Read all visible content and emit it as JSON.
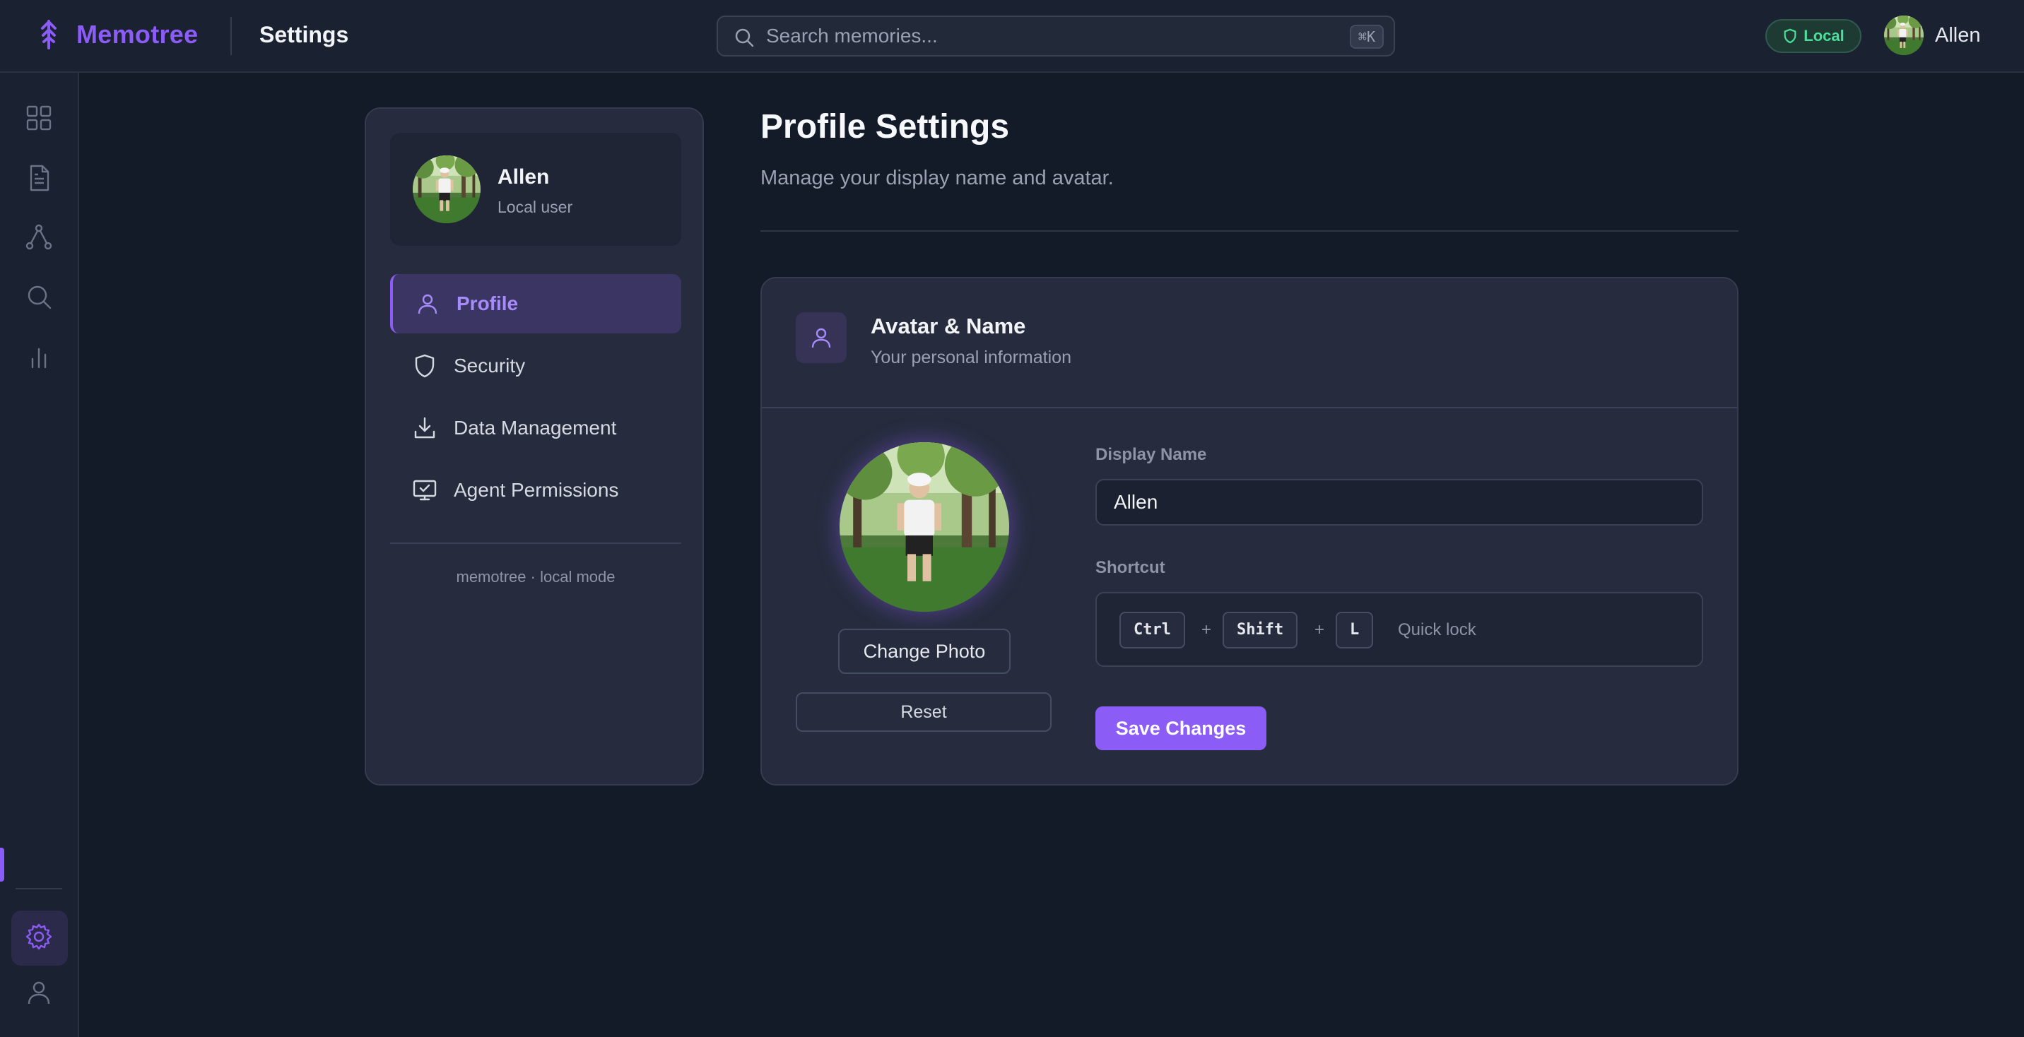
{
  "topbar": {
    "brand": "Memotree",
    "title": "Settings",
    "search_placeholder": "Search memories...",
    "search_shortcut": "⌘K",
    "mode_badge": "Local",
    "username": "Allen"
  },
  "sidebar": {
    "user_name": "Allen",
    "user_role": "Local user",
    "items": [
      {
        "label": "Profile",
        "icon": "user-icon",
        "active": true
      },
      {
        "label": "Security",
        "icon": "shield-icon",
        "active": false
      },
      {
        "label": "Data Management",
        "icon": "download-icon",
        "active": false
      },
      {
        "label": "Agent Permissions",
        "icon": "monitor-check-icon",
        "active": false
      }
    ],
    "footer": "memotree · local mode"
  },
  "rail": {
    "icons": [
      "grid-icon",
      "document-icon",
      "graph-icon",
      "search-icon",
      "chart-icon",
      "settings-icon",
      "user-icon"
    ],
    "active": "settings-icon"
  },
  "main": {
    "title": "Profile Settings",
    "subtitle": "Manage your display name and avatar.",
    "card": {
      "title": "Avatar & Name",
      "subtitle": "Your personal information",
      "change_photo": "Change Photo",
      "reset": "Reset",
      "display_name_label": "Display Name",
      "display_name_value": "Allen",
      "shortcut_label": "Shortcut",
      "shortcut_keys": [
        "Ctrl",
        "Shift",
        "L"
      ],
      "shortcut_plus": "+",
      "shortcut_desc": "Quick lock",
      "save": "Save Changes"
    }
  },
  "colors": {
    "accent": "#8b5cf6",
    "background": "#131a28",
    "panel": "#262c3d",
    "local_badge": "#4ade9a"
  }
}
